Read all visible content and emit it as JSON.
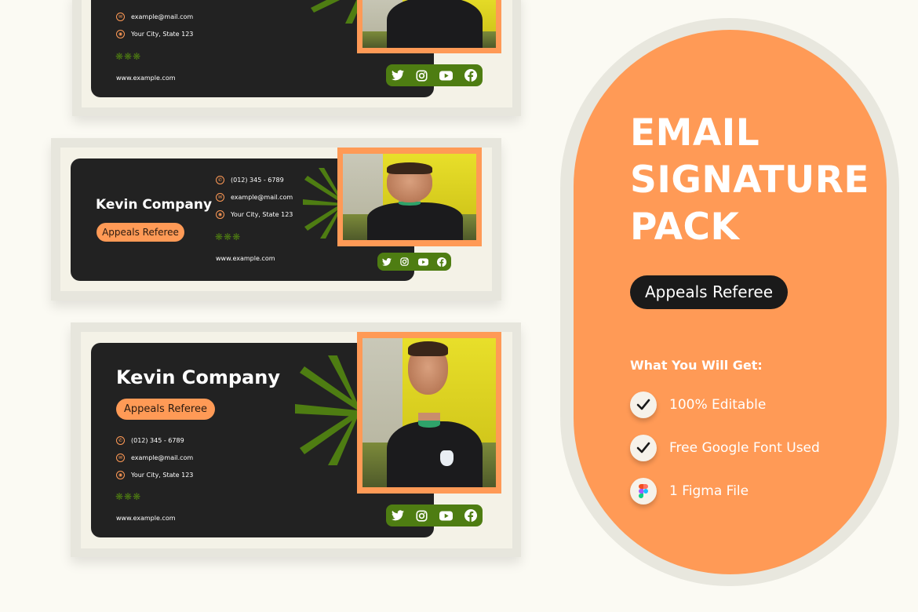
{
  "signature": {
    "name": "Kevin Company",
    "role": "Appeals Referee",
    "phone": "(012) 345 - 6789",
    "email": "example@mail.com",
    "address": "Your City, State 123",
    "decoration": "❋❋❋",
    "website": "www.example.com",
    "photo_alt": "Smiling referee in black kit",
    "social": [
      "twitter-icon",
      "instagram-icon",
      "youtube-icon",
      "facebook-icon"
    ]
  },
  "promo": {
    "title_lines": [
      "EMAIL",
      "SIGNATURE",
      "PACK"
    ],
    "pill_label": "Appeals Referee",
    "subtitle": "What You Will Get:",
    "features": [
      {
        "icon": "check-icon",
        "label": "100% Editable"
      },
      {
        "icon": "check-icon",
        "label": "Free Google Font Used"
      },
      {
        "icon": "figma-icon",
        "label": "1 Figma File"
      }
    ]
  },
  "colors": {
    "background": "#fbfaf3",
    "card_dark": "#222222",
    "accent_orange": "#ff9a56",
    "accent_green": "#4e7d12",
    "pill_dark": "#1a1a1a"
  }
}
